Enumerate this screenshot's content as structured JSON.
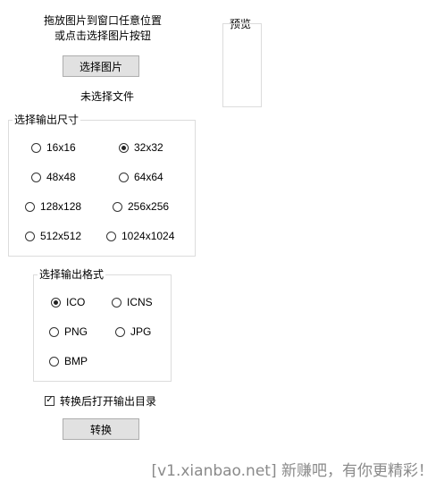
{
  "instructions": {
    "line1": "拖放图片到窗口任意位置",
    "line2": "或点击选择图片按钮"
  },
  "select_image_button": "选择图片",
  "file_status": "未选择文件",
  "preview_label": "预览",
  "size_group": {
    "title": "选择输出尺寸",
    "options": [
      "16x16",
      "32x32",
      "48x48",
      "64x64",
      "128x128",
      "256x256",
      "512x512",
      "1024x1024"
    ],
    "selected": "32x32"
  },
  "format_group": {
    "title": "选择输出格式",
    "options": [
      "ICO",
      "ICNS",
      "PNG",
      "JPG",
      "BMP"
    ],
    "selected": "ICO"
  },
  "open_folder_checkbox": {
    "label": "转换后打开输出目录",
    "checked": true
  },
  "convert_button": "转换",
  "watermark": "[v1.xianbao.net] 新赚吧，有你更精彩！"
}
